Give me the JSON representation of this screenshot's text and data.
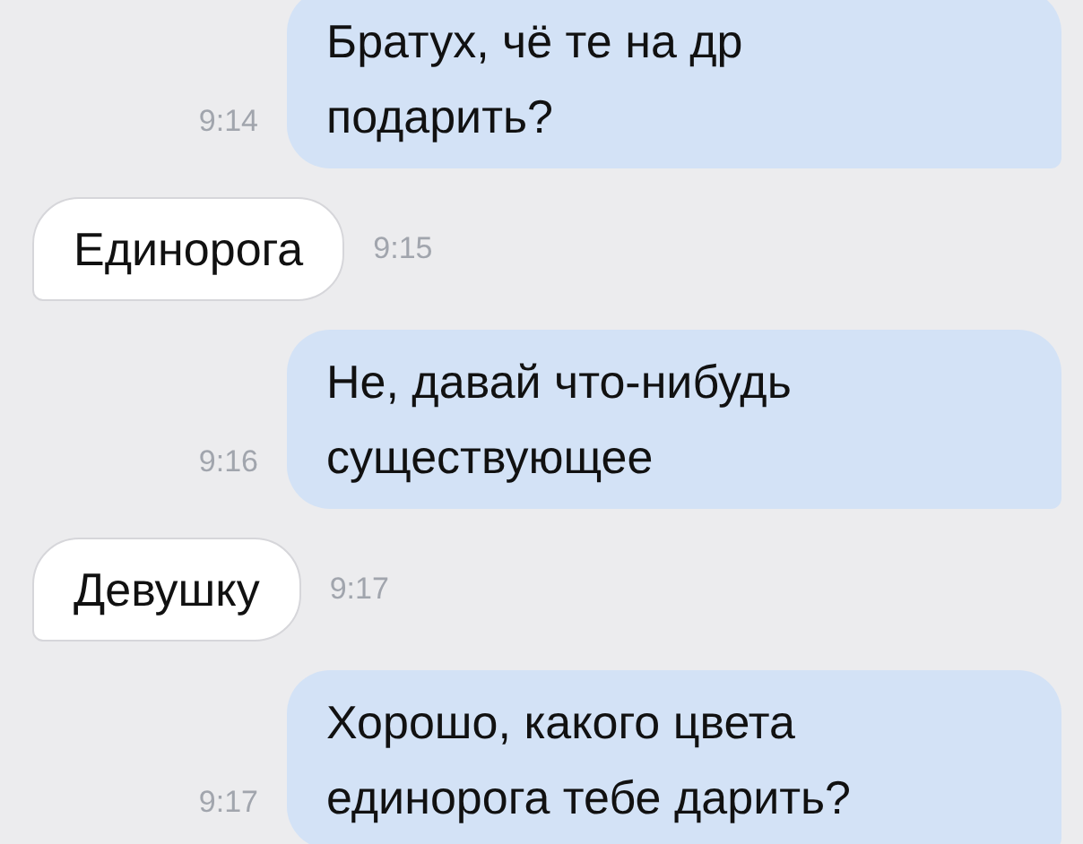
{
  "messages": [
    {
      "kind": "out",
      "text": "Братух, чё те на др\nподарить?",
      "time": "9:14"
    },
    {
      "kind": "in",
      "text": "Единорога",
      "time": "9:15"
    },
    {
      "kind": "out",
      "text": "Не, давай что-нибудь\nсуществующее",
      "time": "9:16"
    },
    {
      "kind": "in",
      "text": "Девушку",
      "time": "9:17"
    },
    {
      "kind": "out",
      "text": "Хорошо, какого цвета\nединорога тебе дарить?",
      "time": "9:17"
    }
  ]
}
